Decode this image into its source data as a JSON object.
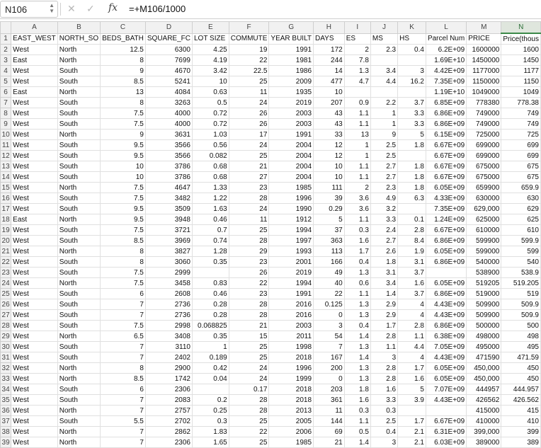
{
  "formula_bar": {
    "cell_ref": "N106",
    "cancel_icon": "✕",
    "confirm_icon": "✓",
    "fx_label": "fx",
    "formula": "=+M106/1000"
  },
  "columns": [
    "A",
    "B",
    "C",
    "D",
    "E",
    "F",
    "G",
    "H",
    "I",
    "J",
    "K",
    "L",
    "M",
    "N"
  ],
  "selected_column": "N",
  "rows": [
    [
      "1",
      "EAST_WEST",
      "NORTH_SO",
      "BEDS_BATH",
      "SQUARE_FC",
      "LOT SIZE",
      "COMMUTE",
      "YEAR BUILT",
      "DAYS",
      "ES",
      "MS",
      "HS",
      "Parcel Num",
      "PRICE",
      "Price(thous"
    ],
    [
      "2",
      "West",
      "North",
      "12.5",
      "6300",
      "4.25",
      "19",
      "1991",
      "172",
      "2",
      "2.3",
      "0.4",
      "6.2E+09",
      "1600000",
      "1600"
    ],
    [
      "3",
      "East",
      "North",
      "8",
      "7699",
      "4.19",
      "22",
      "1981",
      "244",
      "7.8",
      "",
      "",
      "1.69E+10",
      "1450000",
      "1450"
    ],
    [
      "4",
      "West",
      "South",
      "9",
      "4670",
      "3.42",
      "22.5",
      "1986",
      "14",
      "1.3",
      "3.4",
      "3",
      "4.42E+09",
      "1177000",
      "1177"
    ],
    [
      "5",
      "West",
      "South",
      "8.5",
      "5241",
      "10",
      "25",
      "2009",
      "477",
      "4.7",
      "4.4",
      "16.2",
      "7.35E+09",
      "1150000",
      "1150"
    ],
    [
      "6",
      "East",
      "North",
      "13",
      "4084",
      "0.63",
      "11",
      "1935",
      "10",
      "",
      "",
      "",
      "1.19E+10",
      "1049000",
      "1049"
    ],
    [
      "7",
      "West",
      "South",
      "8",
      "3263",
      "0.5",
      "24",
      "2019",
      "207",
      "0.9",
      "2.2",
      "3.7",
      "6.85E+09",
      "778380",
      "778.38"
    ],
    [
      "8",
      "West",
      "South",
      "7.5",
      "4000",
      "0.72",
      "26",
      "2003",
      "43",
      "1.1",
      "1",
      "3.3",
      "6.86E+09",
      "749000",
      "749"
    ],
    [
      "9",
      "West",
      "South",
      "7.5",
      "4000",
      "0.72",
      "26",
      "2003",
      "43",
      "1.1",
      "1",
      "3.3",
      "6.86E+09",
      "749000",
      "749"
    ],
    [
      "10",
      "West",
      "North",
      "9",
      "3631",
      "1.03",
      "17",
      "1991",
      "33",
      "13",
      "9",
      "5",
      "6.15E+09",
      "725000",
      "725"
    ],
    [
      "11",
      "West",
      "South",
      "9.5",
      "3566",
      "0.56",
      "24",
      "2004",
      "12",
      "1",
      "2.5",
      "1.8",
      "6.67E+09",
      "699000",
      "699"
    ],
    [
      "12",
      "West",
      "South",
      "9.5",
      "3566",
      "0.082",
      "25",
      "2004",
      "12",
      "1",
      "2.5",
      "",
      "6.67E+09",
      "699000",
      "699"
    ],
    [
      "13",
      "West",
      "South",
      "10",
      "3786",
      "0.68",
      "21",
      "2004",
      "10",
      "1.1",
      "2.7",
      "1.8",
      "6.67E+09",
      "675000",
      "675"
    ],
    [
      "14",
      "West",
      "South",
      "10",
      "3786",
      "0.68",
      "27",
      "2004",
      "10",
      "1.1",
      "2.7",
      "1.8",
      "6.67E+09",
      "675000",
      "675"
    ],
    [
      "15",
      "West",
      "North",
      "7.5",
      "4647",
      "1.33",
      "23",
      "1985",
      "111",
      "2",
      "2.3",
      "1.8",
      "6.05E+09",
      "659900",
      "659.9"
    ],
    [
      "16",
      "West",
      "South",
      "7.5",
      "3482",
      "1.22",
      "28",
      "1996",
      "39",
      "3.6",
      "4.9",
      "6.3",
      "4.33E+09",
      "630000",
      "630"
    ],
    [
      "17",
      "West",
      "South",
      "9.5",
      "3509",
      "1.63",
      "24",
      "1990",
      "0.29",
      "3.6",
      "3.2",
      "",
      "7.35E+09",
      "629,000",
      "629"
    ],
    [
      "18",
      "East",
      "North",
      "9.5",
      "3948",
      "0.46",
      "11",
      "1912",
      "5",
      "1.1",
      "3.3",
      "0.1",
      "1.24E+09",
      "625000",
      "625"
    ],
    [
      "19",
      "West",
      "South",
      "7.5",
      "3721",
      "0.7",
      "25",
      "1994",
      "37",
      "0.3",
      "2.4",
      "2.8",
      "6.67E+09",
      "610000",
      "610"
    ],
    [
      "20",
      "West",
      "South",
      "8.5",
      "3969",
      "0.74",
      "28",
      "1997",
      "363",
      "1.6",
      "2.7",
      "8.4",
      "6.86E+09",
      "599900",
      "599.9"
    ],
    [
      "21",
      "West",
      "North",
      "8",
      "3827",
      "1.28",
      "29",
      "1993",
      "113",
      "1.7",
      "2.6",
      "1.9",
      "6.05E+09",
      "599000",
      "599"
    ],
    [
      "22",
      "West",
      "South",
      "8",
      "3060",
      "0.35",
      "23",
      "2001",
      "166",
      "0.4",
      "1.8",
      "3.1",
      "6.86E+09",
      "540000",
      "540"
    ],
    [
      "23",
      "West",
      "South",
      "7.5",
      "2999",
      "",
      "26",
      "2019",
      "49",
      "1.3",
      "3.1",
      "3.7",
      "",
      "538900",
      "538.9"
    ],
    [
      "24",
      "West",
      "North",
      "7.5",
      "3458",
      "0.83",
      "22",
      "1994",
      "40",
      "0.6",
      "3.4",
      "1.6",
      "6.05E+09",
      "519205",
      "519.205"
    ],
    [
      "25",
      "West",
      "South",
      "6",
      "2608",
      "0.46",
      "23",
      "1991",
      "22",
      "1.1",
      "1.4",
      "3.7",
      "6.86E+09",
      "519000",
      "519"
    ],
    [
      "26",
      "West",
      "South",
      "7",
      "2736",
      "0.28",
      "28",
      "2016",
      "0.125",
      "1.3",
      "2.9",
      "4",
      "4.43E+09",
      "509900",
      "509.9"
    ],
    [
      "27",
      "West",
      "South",
      "7",
      "2736",
      "0.28",
      "28",
      "2016",
      "0",
      "1.3",
      "2.9",
      "4",
      "4.43E+09",
      "509900",
      "509.9"
    ],
    [
      "28",
      "West",
      "South",
      "7.5",
      "2998",
      "0.068825",
      "21",
      "2003",
      "3",
      "0.4",
      "1.7",
      "2.8",
      "6.86E+09",
      "500000",
      "500"
    ],
    [
      "29",
      "West",
      "North",
      "6.5",
      "3408",
      "0.35",
      "15",
      "2011",
      "54",
      "1.4",
      "2.8",
      "1.1",
      "6.38E+09",
      "498000",
      "498"
    ],
    [
      "30",
      "West",
      "South",
      "7",
      "3110",
      "1",
      "25",
      "1998",
      "7",
      "1.3",
      "1.1",
      "4.4",
      "7.05E+09",
      "495000",
      "495"
    ],
    [
      "31",
      "West",
      "South",
      "7",
      "2402",
      "0.189",
      "25",
      "2018",
      "167",
      "1.4",
      "3",
      "4",
      "4.43E+09",
      "471590",
      "471.59"
    ],
    [
      "32",
      "West",
      "North",
      "8",
      "2900",
      "0.42",
      "24",
      "1996",
      "200",
      "1.3",
      "2.8",
      "1.7",
      "6.05E+09",
      "450,000",
      "450"
    ],
    [
      "33",
      "West",
      "North",
      "8.5",
      "1742",
      "0.04",
      "24",
      "1999",
      "0",
      "1.3",
      "2.8",
      "1.6",
      "6.05E+09",
      "450,000",
      "450"
    ],
    [
      "34",
      "West",
      "South",
      "6",
      "2306",
      "",
      "0.17",
      "2018",
      "203",
      "1.8",
      "1.6",
      "5",
      "7.07E+09",
      "444957",
      "444.957"
    ],
    [
      "35",
      "West",
      "South",
      "7",
      "2083",
      "0.2",
      "28",
      "2018",
      "361",
      "1.6",
      "3.3",
      "3.9",
      "4.43E+09",
      "426562",
      "426.562"
    ],
    [
      "36",
      "West",
      "North",
      "7",
      "2757",
      "0.25",
      "28",
      "2013",
      "11",
      "0.3",
      "0.3",
      "",
      "",
      "415000",
      "415"
    ],
    [
      "37",
      "West",
      "South",
      "5.5",
      "2702",
      "0.3",
      "25",
      "2005",
      "144",
      "1.1",
      "2.5",
      "1.7",
      "6.67E+09",
      "410000",
      "410"
    ],
    [
      "38",
      "West",
      "North",
      "7",
      "2862",
      "1.83",
      "22",
      "2006",
      "69",
      "0.5",
      "0.4",
      "2.1",
      "6.31E+09",
      "399,000",
      "399"
    ],
    [
      "39",
      "West",
      "North",
      "7",
      "2306",
      "1.65",
      "25",
      "1985",
      "21",
      "1.4",
      "3",
      "2.1",
      "6.03E+09",
      "389000",
      "389"
    ]
  ]
}
